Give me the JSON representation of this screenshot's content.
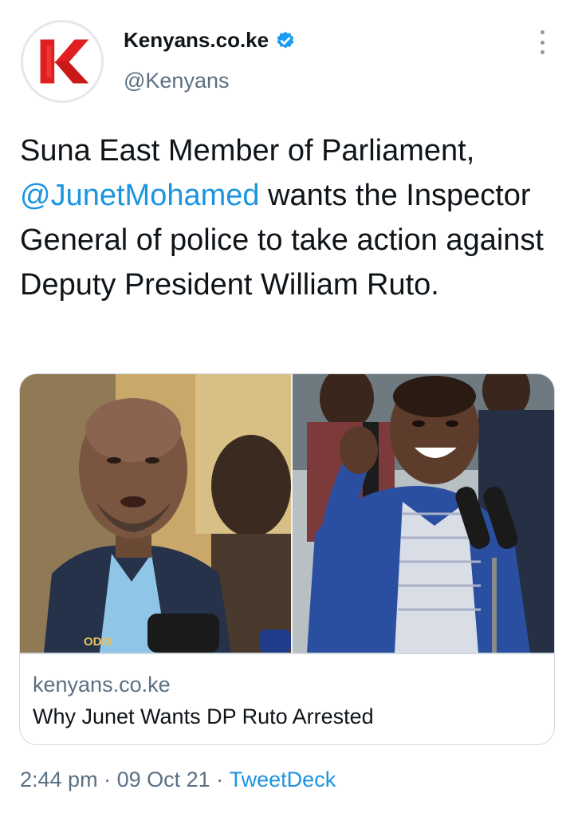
{
  "author": {
    "display_name": "Kenyans.co.ke",
    "handle": "@Kenyans",
    "verified": true,
    "avatar_icon": "kenyans-k-logo",
    "brand_color": "#e02020"
  },
  "tweet": {
    "text_part1": "Suna East Member of Parliament, ",
    "mention": "@JunetMohamed",
    "text_part2": " wants the Inspector General of police to take action against Deputy President William Ruto."
  },
  "card": {
    "domain": "kenyans.co.ke",
    "title": "Why Junet Wants DP Ruto Arrested",
    "image_watermark": "ODM"
  },
  "meta": {
    "time": "2:44 pm",
    "separator": " · ",
    "date": "09 Oct 21",
    "source": "TweetDeck"
  },
  "colors": {
    "link": "#1b95e0",
    "secondary_text": "#5b7083",
    "primary_text": "#0f1419",
    "verified_badge": "#1d9bf0"
  }
}
